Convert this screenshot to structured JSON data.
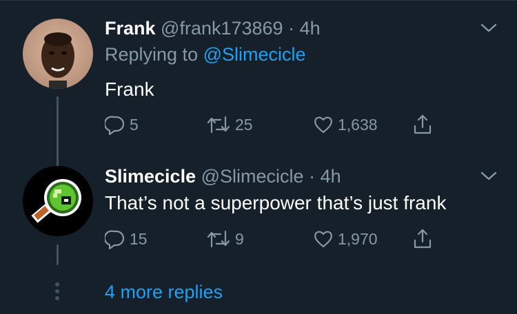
{
  "tweets": [
    {
      "display_name": "Frank",
      "handle": "@frank173869",
      "separator": "·",
      "time": "4h",
      "replying_prefix": "Replying to",
      "replying_to": "@Slimecicle",
      "text": "Frank",
      "replies": "5",
      "retweets": "25",
      "likes": "1,638",
      "avatar_icon": "person-photo-avatar"
    },
    {
      "display_name": "Slimecicle",
      "handle": "@Slimecicle",
      "separator": "·",
      "time": "4h",
      "text": "That’s not a superpower that’s just frank",
      "replies": "15",
      "retweets": "9",
      "likes": "1,970",
      "avatar_icon": "pixel-slime-magnifier-avatar"
    }
  ],
  "more_replies": "4 more replies",
  "colors": {
    "background": "#15202b",
    "text": "#ffffff",
    "muted": "#8899a6",
    "link": "#1da1f2",
    "thread_line": "#3d5466"
  },
  "icons": [
    "reply-icon",
    "retweet-icon",
    "like-icon",
    "share-icon",
    "chevron-down-icon"
  ]
}
